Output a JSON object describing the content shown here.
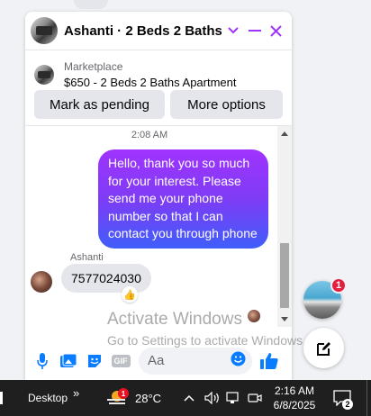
{
  "chat": {
    "title": "Ashanti · 2 Beds 2 Baths A...",
    "marketplace_source": "Marketplace",
    "marketplace_item": "$650 - 2 Beds 2 Baths Apartment",
    "mark_pending_label": "Mark as pending",
    "more_options_label": "More options",
    "timestamp": "2:08 AM",
    "outgoing_message": "Hello, thank you so much for your interest. Please send me your phone number so that I can contact you through phone",
    "sender_name": "Ashanti",
    "incoming_message": "7577024030",
    "reaction_emoji": "👍",
    "composer_placeholder": "Aa",
    "gif_label": "GIF",
    "accent_color": "#a033ff"
  },
  "floating": {
    "unread_badge": "1"
  },
  "watermark": {
    "line1": "Activate Windows",
    "line2": "Go to Settings to activate Windows."
  },
  "taskbar": {
    "desktop_label": "Desktop",
    "chevron": "»",
    "weather_badge": "1",
    "temperature": "28°C",
    "time": "2:16 AM",
    "date": "6/8/2025",
    "notification_count": "2"
  }
}
